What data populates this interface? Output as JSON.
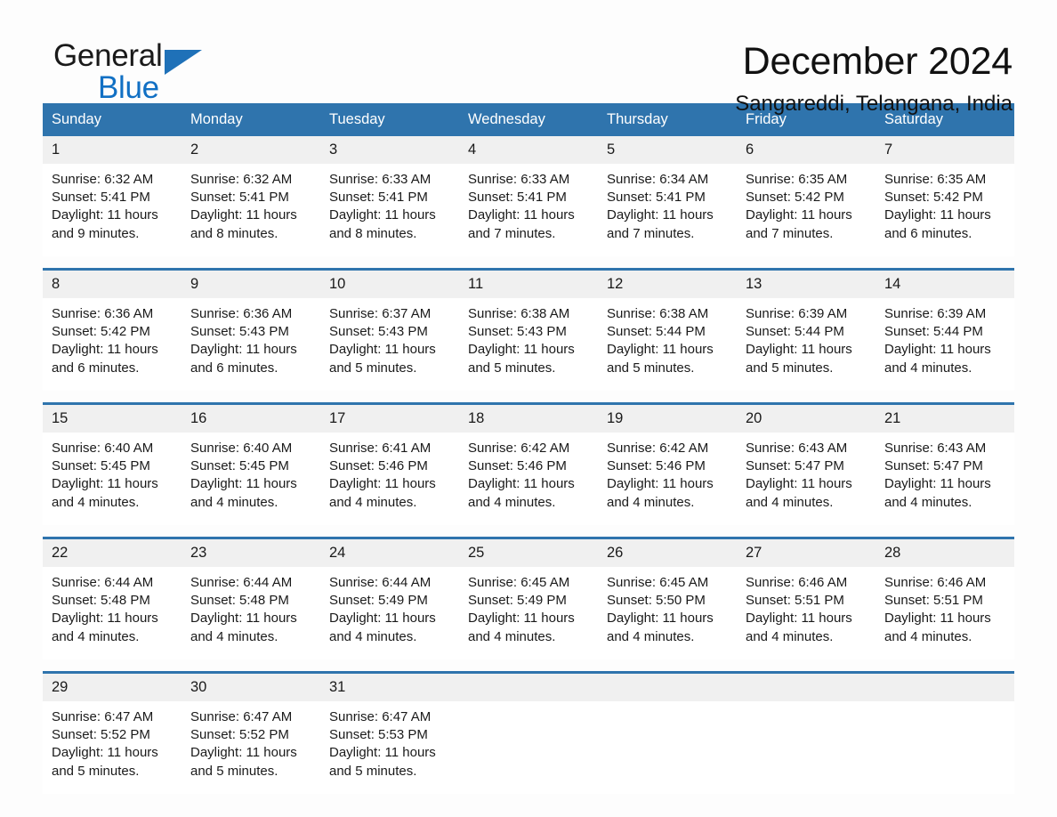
{
  "logo": {
    "word1": "General",
    "word2": "Blue",
    "triangle_color": "#1f71b8",
    "text_color": "#1a1a1a",
    "blue_color": "#1170c4"
  },
  "header": {
    "title": "December 2024",
    "location": "Sangareddi, Telangana, India"
  },
  "theme": {
    "header_blue": "#2f74ad",
    "row_rule_blue": "#2f74ad",
    "daynum_band": "#f0f0f0",
    "page_bg": "#fdfdfd"
  },
  "calendar": {
    "weekday_headers": [
      "Sunday",
      "Monday",
      "Tuesday",
      "Wednesday",
      "Thursday",
      "Friday",
      "Saturday"
    ],
    "weeks": [
      [
        {
          "day": "1",
          "sunrise": "Sunrise: 6:32 AM",
          "sunset": "Sunset: 5:41 PM",
          "daylight": "Daylight: 11 hours and 9 minutes."
        },
        {
          "day": "2",
          "sunrise": "Sunrise: 6:32 AM",
          "sunset": "Sunset: 5:41 PM",
          "daylight": "Daylight: 11 hours and 8 minutes."
        },
        {
          "day": "3",
          "sunrise": "Sunrise: 6:33 AM",
          "sunset": "Sunset: 5:41 PM",
          "daylight": "Daylight: 11 hours and 8 minutes."
        },
        {
          "day": "4",
          "sunrise": "Sunrise: 6:33 AM",
          "sunset": "Sunset: 5:41 PM",
          "daylight": "Daylight: 11 hours and 7 minutes."
        },
        {
          "day": "5",
          "sunrise": "Sunrise: 6:34 AM",
          "sunset": "Sunset: 5:41 PM",
          "daylight": "Daylight: 11 hours and 7 minutes."
        },
        {
          "day": "6",
          "sunrise": "Sunrise: 6:35 AM",
          "sunset": "Sunset: 5:42 PM",
          "daylight": "Daylight: 11 hours and 7 minutes."
        },
        {
          "day": "7",
          "sunrise": "Sunrise: 6:35 AM",
          "sunset": "Sunset: 5:42 PM",
          "daylight": "Daylight: 11 hours and 6 minutes."
        }
      ],
      [
        {
          "day": "8",
          "sunrise": "Sunrise: 6:36 AM",
          "sunset": "Sunset: 5:42 PM",
          "daylight": "Daylight: 11 hours and 6 minutes."
        },
        {
          "day": "9",
          "sunrise": "Sunrise: 6:36 AM",
          "sunset": "Sunset: 5:43 PM",
          "daylight": "Daylight: 11 hours and 6 minutes."
        },
        {
          "day": "10",
          "sunrise": "Sunrise: 6:37 AM",
          "sunset": "Sunset: 5:43 PM",
          "daylight": "Daylight: 11 hours and 5 minutes."
        },
        {
          "day": "11",
          "sunrise": "Sunrise: 6:38 AM",
          "sunset": "Sunset: 5:43 PM",
          "daylight": "Daylight: 11 hours and 5 minutes."
        },
        {
          "day": "12",
          "sunrise": "Sunrise: 6:38 AM",
          "sunset": "Sunset: 5:44 PM",
          "daylight": "Daylight: 11 hours and 5 minutes."
        },
        {
          "day": "13",
          "sunrise": "Sunrise: 6:39 AM",
          "sunset": "Sunset: 5:44 PM",
          "daylight": "Daylight: 11 hours and 5 minutes."
        },
        {
          "day": "14",
          "sunrise": "Sunrise: 6:39 AM",
          "sunset": "Sunset: 5:44 PM",
          "daylight": "Daylight: 11 hours and 4 minutes."
        }
      ],
      [
        {
          "day": "15",
          "sunrise": "Sunrise: 6:40 AM",
          "sunset": "Sunset: 5:45 PM",
          "daylight": "Daylight: 11 hours and 4 minutes."
        },
        {
          "day": "16",
          "sunrise": "Sunrise: 6:40 AM",
          "sunset": "Sunset: 5:45 PM",
          "daylight": "Daylight: 11 hours and 4 minutes."
        },
        {
          "day": "17",
          "sunrise": "Sunrise: 6:41 AM",
          "sunset": "Sunset: 5:46 PM",
          "daylight": "Daylight: 11 hours and 4 minutes."
        },
        {
          "day": "18",
          "sunrise": "Sunrise: 6:42 AM",
          "sunset": "Sunset: 5:46 PM",
          "daylight": "Daylight: 11 hours and 4 minutes."
        },
        {
          "day": "19",
          "sunrise": "Sunrise: 6:42 AM",
          "sunset": "Sunset: 5:46 PM",
          "daylight": "Daylight: 11 hours and 4 minutes."
        },
        {
          "day": "20",
          "sunrise": "Sunrise: 6:43 AM",
          "sunset": "Sunset: 5:47 PM",
          "daylight": "Daylight: 11 hours and 4 minutes."
        },
        {
          "day": "21",
          "sunrise": "Sunrise: 6:43 AM",
          "sunset": "Sunset: 5:47 PM",
          "daylight": "Daylight: 11 hours and 4 minutes."
        }
      ],
      [
        {
          "day": "22",
          "sunrise": "Sunrise: 6:44 AM",
          "sunset": "Sunset: 5:48 PM",
          "daylight": "Daylight: 11 hours and 4 minutes."
        },
        {
          "day": "23",
          "sunrise": "Sunrise: 6:44 AM",
          "sunset": "Sunset: 5:48 PM",
          "daylight": "Daylight: 11 hours and 4 minutes."
        },
        {
          "day": "24",
          "sunrise": "Sunrise: 6:44 AM",
          "sunset": "Sunset: 5:49 PM",
          "daylight": "Daylight: 11 hours and 4 minutes."
        },
        {
          "day": "25",
          "sunrise": "Sunrise: 6:45 AM",
          "sunset": "Sunset: 5:49 PM",
          "daylight": "Daylight: 11 hours and 4 minutes."
        },
        {
          "day": "26",
          "sunrise": "Sunrise: 6:45 AM",
          "sunset": "Sunset: 5:50 PM",
          "daylight": "Daylight: 11 hours and 4 minutes."
        },
        {
          "day": "27",
          "sunrise": "Sunrise: 6:46 AM",
          "sunset": "Sunset: 5:51 PM",
          "daylight": "Daylight: 11 hours and 4 minutes."
        },
        {
          "day": "28",
          "sunrise": "Sunrise: 6:46 AM",
          "sunset": "Sunset: 5:51 PM",
          "daylight": "Daylight: 11 hours and 4 minutes."
        }
      ],
      [
        {
          "day": "29",
          "sunrise": "Sunrise: 6:47 AM",
          "sunset": "Sunset: 5:52 PM",
          "daylight": "Daylight: 11 hours and 5 minutes."
        },
        {
          "day": "30",
          "sunrise": "Sunrise: 6:47 AM",
          "sunset": "Sunset: 5:52 PM",
          "daylight": "Daylight: 11 hours and 5 minutes."
        },
        {
          "day": "31",
          "sunrise": "Sunrise: 6:47 AM",
          "sunset": "Sunset: 5:53 PM",
          "daylight": "Daylight: 11 hours and 5 minutes."
        },
        {
          "day": "",
          "sunrise": "",
          "sunset": "",
          "daylight": ""
        },
        {
          "day": "",
          "sunrise": "",
          "sunset": "",
          "daylight": ""
        },
        {
          "day": "",
          "sunrise": "",
          "sunset": "",
          "daylight": ""
        },
        {
          "day": "",
          "sunrise": "",
          "sunset": "",
          "daylight": ""
        }
      ]
    ]
  }
}
